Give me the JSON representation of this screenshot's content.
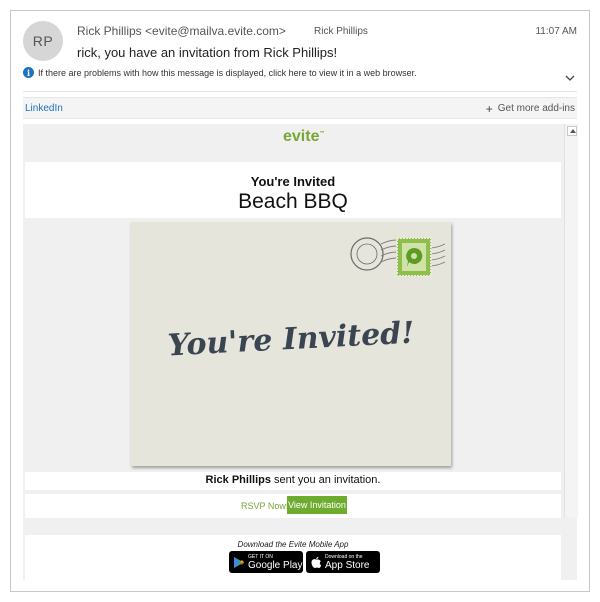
{
  "header": {
    "avatar_initials": "RP",
    "from": "Rick Phillips <evite@mailva.evite.com>",
    "to": "Rick Phillips",
    "time": "11:07 AM",
    "subject": "rick, you have an invitation from Rick Phillips!",
    "notice": "If there are problems with how this message is displayed, click here to view it in a web browser."
  },
  "addins": {
    "linkedin": "LinkedIn",
    "get_more": "Get more add-ins"
  },
  "email": {
    "logo": "evite",
    "invited_heading": "You're Invited",
    "event_title": "Beach BBQ",
    "envelope_text": "You're Invited!",
    "sender_name": "Rick Phillips",
    "sent_suffix": " sent you an invitation.",
    "rsvp_text": "RSVP Now!",
    "view_button": "View Invitation",
    "app_heading": "Download the Evite Mobile App",
    "google_small": "GET IT ON",
    "google_big": "Google Play",
    "apple_small": "Download on the",
    "apple_big": "App Store"
  },
  "colors": {
    "accent": "#7aa537",
    "button": "#6eac2f",
    "link": "#1e73be"
  }
}
